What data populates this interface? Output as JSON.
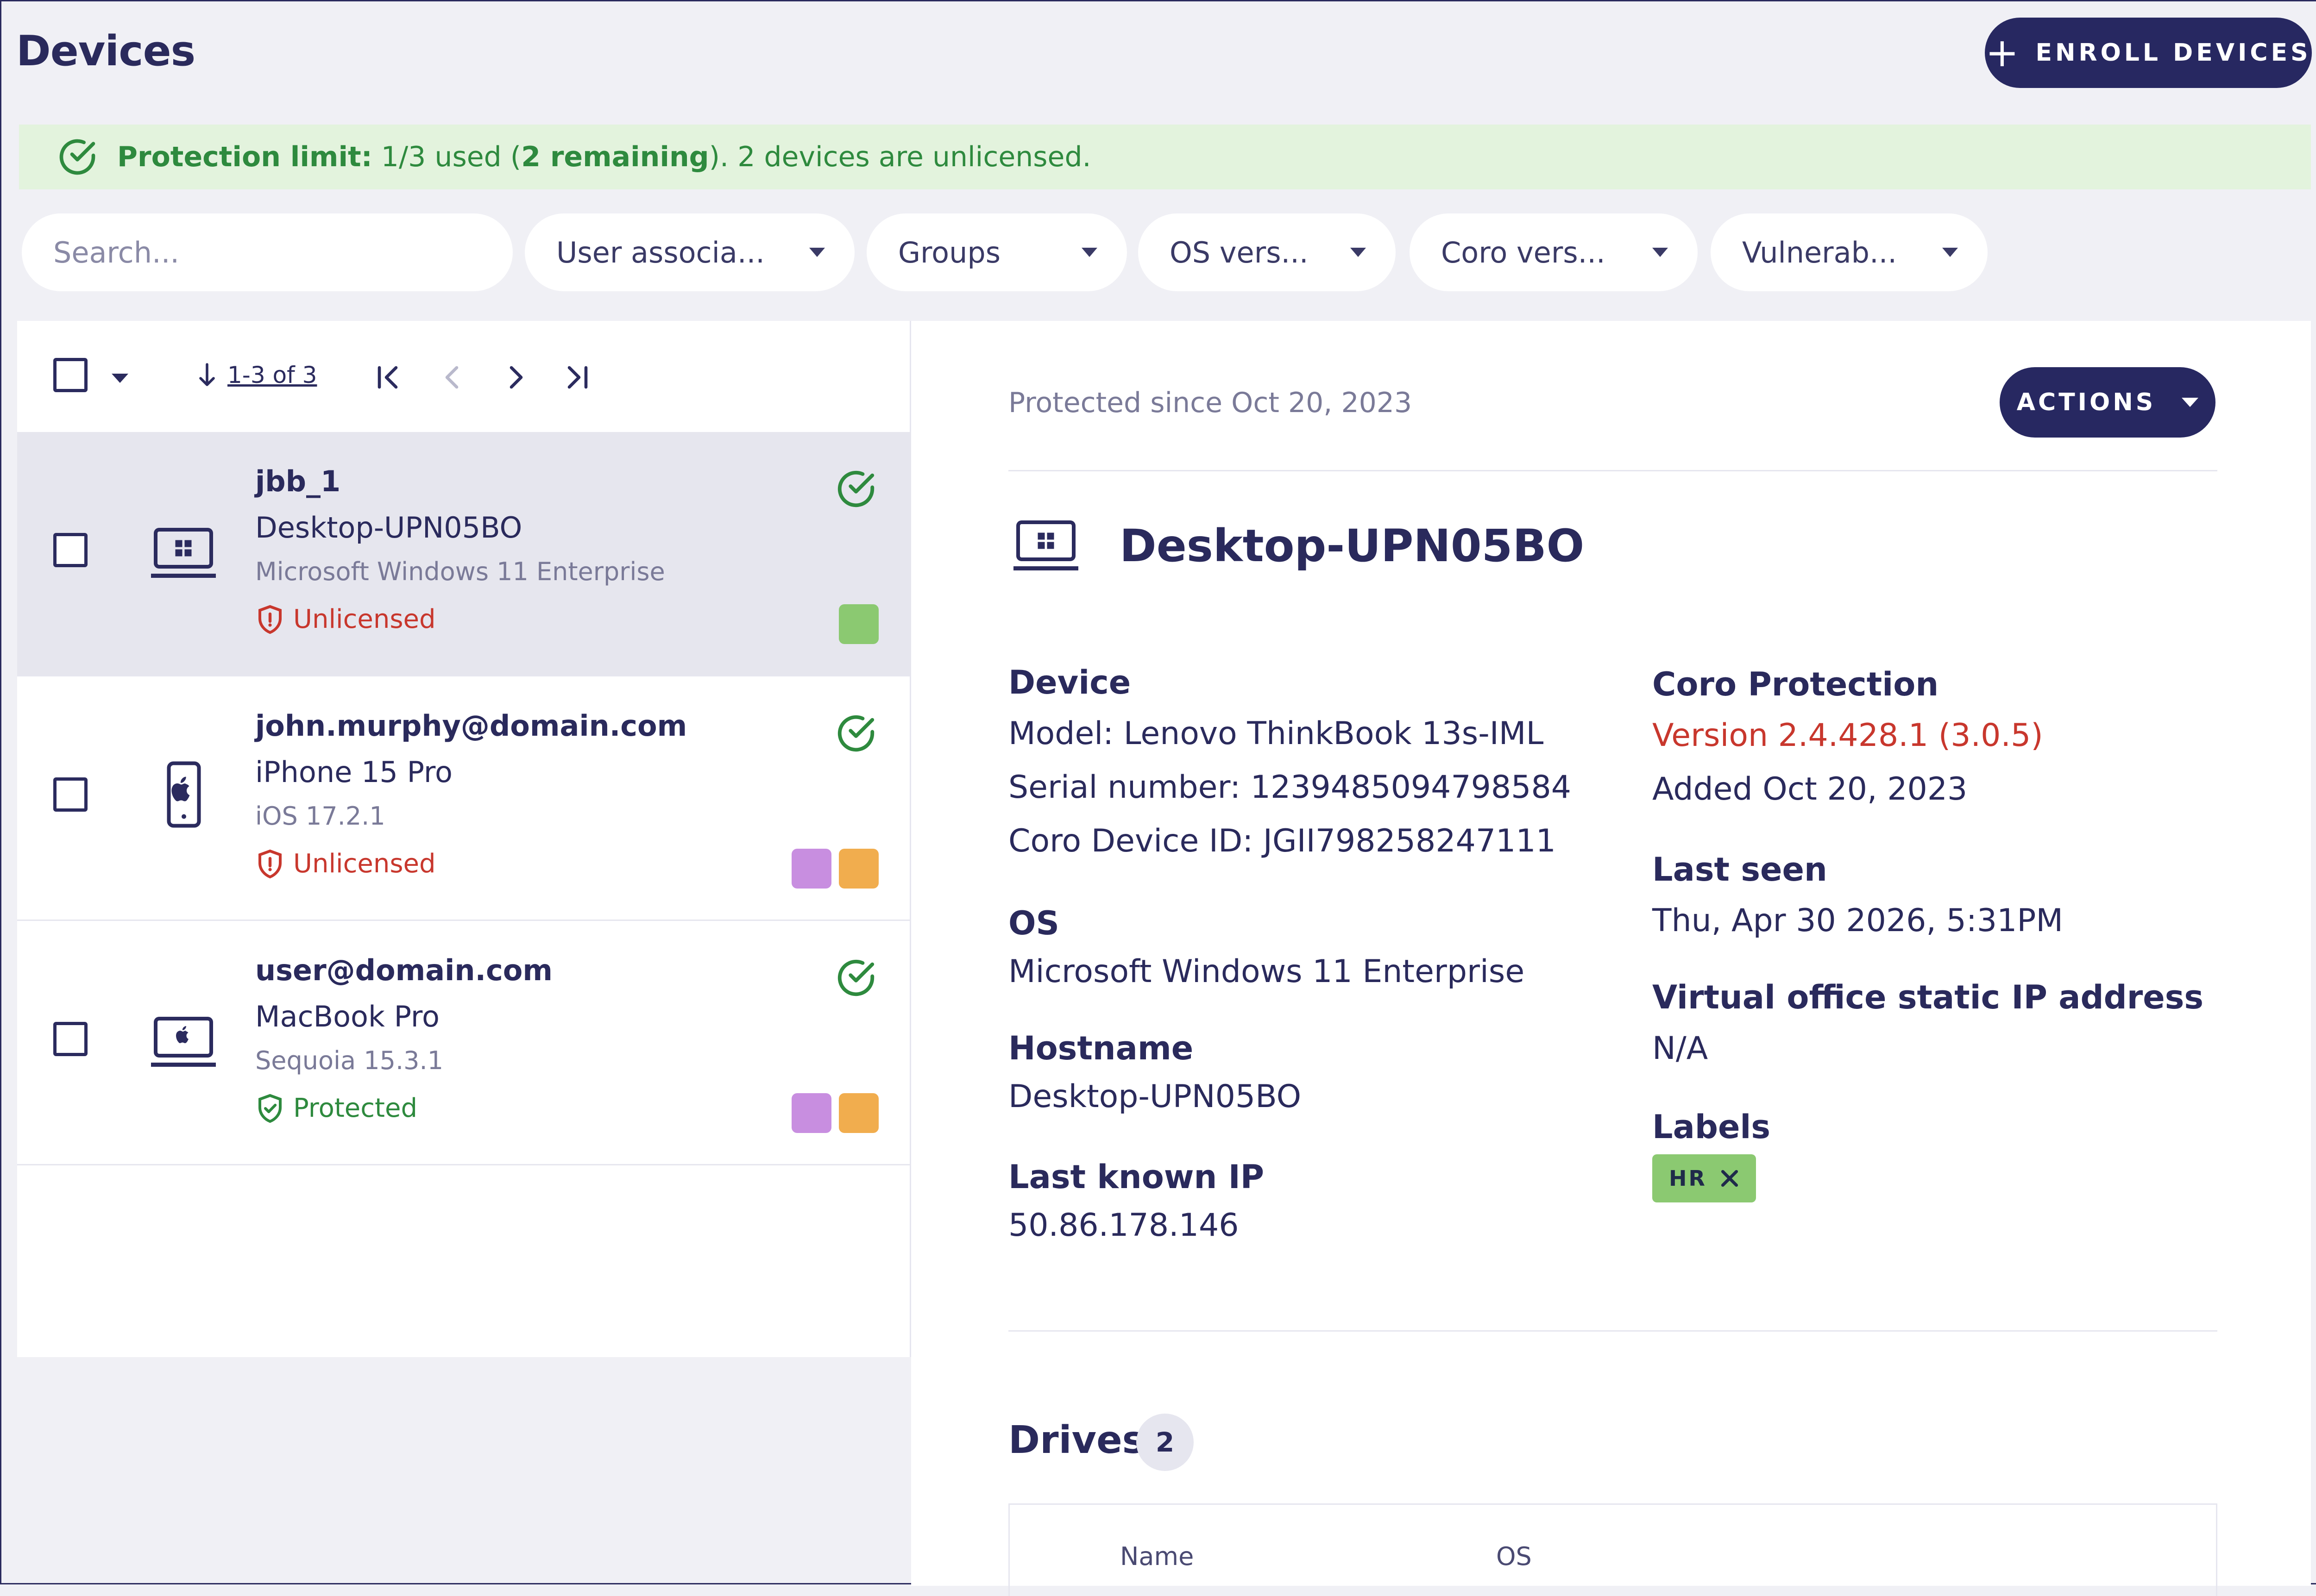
{
  "header": {
    "title": "Devices",
    "enroll_label": "ENROLL DEVICES"
  },
  "banner": {
    "label": "Protection limit:",
    "used": "1/3 used (",
    "remaining": "2 remaining",
    "tail": "). 2 devices are unlicensed."
  },
  "filters": {
    "search_placeholder": "Search...",
    "user_association": "User associa...",
    "groups": "Groups",
    "os_version": "OS vers...",
    "coro_version": "Coro vers...",
    "vulnerabilities": "Vulnerab..."
  },
  "list": {
    "pager": "1-3 of 3",
    "devices": [
      {
        "user": "jbb_1",
        "name": "Desktop-UPN05BO",
        "os": "Microsoft Windows 11 Enterprise",
        "status": "Unlicensed",
        "status_color": "#c8372d",
        "tags": [
          "#8bc971"
        ],
        "icon": "windows-desktop-icon"
      },
      {
        "user": "john.murphy@domain.com",
        "name": "iPhone 15 Pro",
        "os": "iOS 17.2.1",
        "status": "Unlicensed",
        "status_color": "#c8372d",
        "tags": [
          "#c88ee0",
          "#f1ad4e"
        ],
        "icon": "apple-phone-icon"
      },
      {
        "user": "user@domain.com",
        "name": "MacBook Pro",
        "os": "Sequoia 15.3.1",
        "status": "Protected",
        "status_color": "#2e8a3e",
        "tags": [
          "#c88ee0",
          "#f1ad4e"
        ],
        "icon": "apple-laptop-icon"
      }
    ]
  },
  "detail": {
    "protected_since": "Protected since Oct 20, 2023",
    "actions_label": "ACTIONS",
    "device_title": "Desktop-UPN05BO",
    "device_heading": "Device",
    "model": "Model: Lenovo ThinkBook 13s-IML",
    "serial": "Serial number: 1239485094798584",
    "coro_id": "Coro Device ID: JGII798258247111",
    "os_heading": "OS",
    "os_value": "Microsoft Windows 11 Enterprise",
    "hostname_heading": "Hostname",
    "hostname_value": "Desktop-UPN05BO",
    "ip_heading": "Last known IP",
    "ip_value": "50.86.178.146",
    "coro_heading": "Coro Protection",
    "coro_version": "Version 2.4.428.1 (3.0.5)",
    "coro_added": "Added Oct 20, 2023",
    "last_seen_heading": "Last seen",
    "last_seen_value": "Thu, Apr 30 2026, 5:31PM",
    "vo_heading": "Virtual office static IP address",
    "vo_value": "N/A",
    "labels_heading": "Labels",
    "label_chip": "HR",
    "drives_heading": "Drives",
    "drives_count": "2",
    "drives_col_name": "Name",
    "drives_col_os": "OS"
  },
  "colors": {
    "primary": "#272861",
    "success": "#2e8a3e",
    "danger": "#c8372d",
    "banner_bg": "#e3f3dd",
    "label_green": "#8bc971"
  }
}
